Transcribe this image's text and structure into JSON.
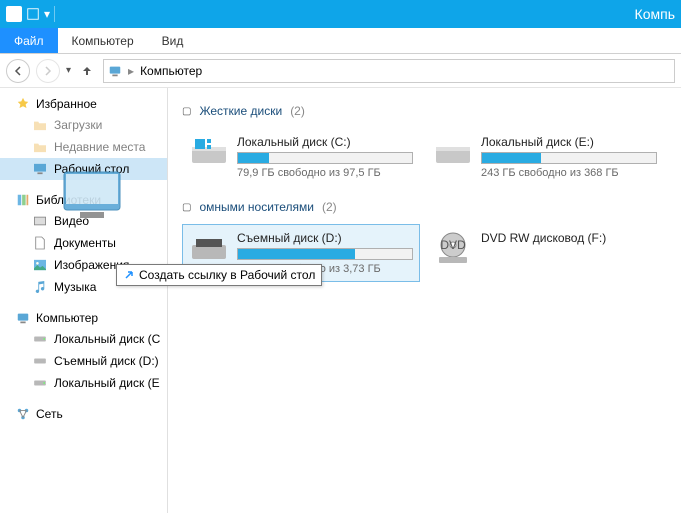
{
  "titlebar": {
    "title": "Компь"
  },
  "ribbon": {
    "file": "Файл",
    "tabs": [
      "Компьютер",
      "Вид"
    ]
  },
  "addressbar": {
    "location": "Компьютер"
  },
  "sidebar": {
    "favorites": {
      "label": "Избранное",
      "items": [
        {
          "label": "Загрузки"
        },
        {
          "label": "Недавние места"
        },
        {
          "label": "Рабочий стол",
          "selected": true
        }
      ]
    },
    "libraries": {
      "label": "Библиотеки",
      "items": [
        {
          "label": "Видео"
        },
        {
          "label": "Документы"
        },
        {
          "label": "Изображения"
        },
        {
          "label": "Музыка"
        }
      ]
    },
    "computer": {
      "label": "Компьютер",
      "items": [
        {
          "label": "Локальный диск (C"
        },
        {
          "label": "Съемный диск (D:)"
        },
        {
          "label": "Локальный диск (E"
        }
      ]
    },
    "network": {
      "label": "Сеть"
    }
  },
  "content": {
    "section_hdd": {
      "title": "Жесткие диски",
      "count": "(2)"
    },
    "section_removable": {
      "title": "омными носителями",
      "count": "(2)"
    },
    "drives": {
      "c": {
        "name": "Локальный диск (C:)",
        "status": "79,9 ГБ свободно из 97,5 ГБ",
        "fill": 18
      },
      "e": {
        "name": "Локальный диск (E:)",
        "status": "243 ГБ свободно из 368 ГБ",
        "fill": 34
      },
      "d": {
        "name": "Съемный диск (D:)",
        "status": "1,23 ГБ свободно из 3,73 ГБ",
        "fill": 67,
        "selected": true
      },
      "f": {
        "name": "DVD RW дисковод (F:)"
      }
    }
  },
  "tooltip": {
    "text": "Создать ссылку в Рабочий стол"
  }
}
